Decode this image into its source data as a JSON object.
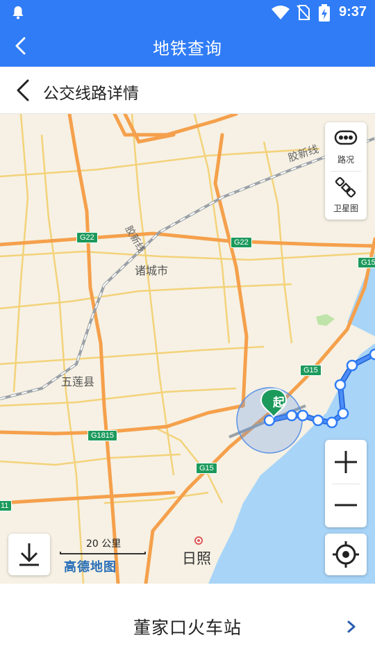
{
  "status_bar": {
    "time": "9:37",
    "icons": [
      "notification-bell-icon",
      "wifi-icon",
      "no-sim-icon",
      "battery-charging-icon"
    ]
  },
  "app_bar": {
    "title": "地铁查询",
    "back_icon": "chevron-left-icon"
  },
  "sub_header": {
    "title": "公交线路详情",
    "back_icon": "chevron-left-icon"
  },
  "map": {
    "place_labels": [
      "诸城市",
      "五莲县",
      "日照"
    ],
    "railway_labels": [
      "胶新线",
      "胶新线"
    ],
    "road_shields": [
      "G22",
      "G22",
      "G15",
      "G15",
      "G15",
      "G1815",
      "G15",
      "11"
    ],
    "start_marker": "起",
    "controls": {
      "traffic_label": "路况",
      "satellite_label": "卫星图"
    },
    "scale_text": "20 公里",
    "brand_text": "高德地图",
    "colors": {
      "route": "#2f7cf6",
      "highway": "#f5a04c",
      "sea": "#a8d4f8",
      "start_marker": "#1c9a5c"
    }
  },
  "bottom": {
    "station_name": "董家口火车站",
    "arrow_icon": "chevron-right-icon"
  }
}
